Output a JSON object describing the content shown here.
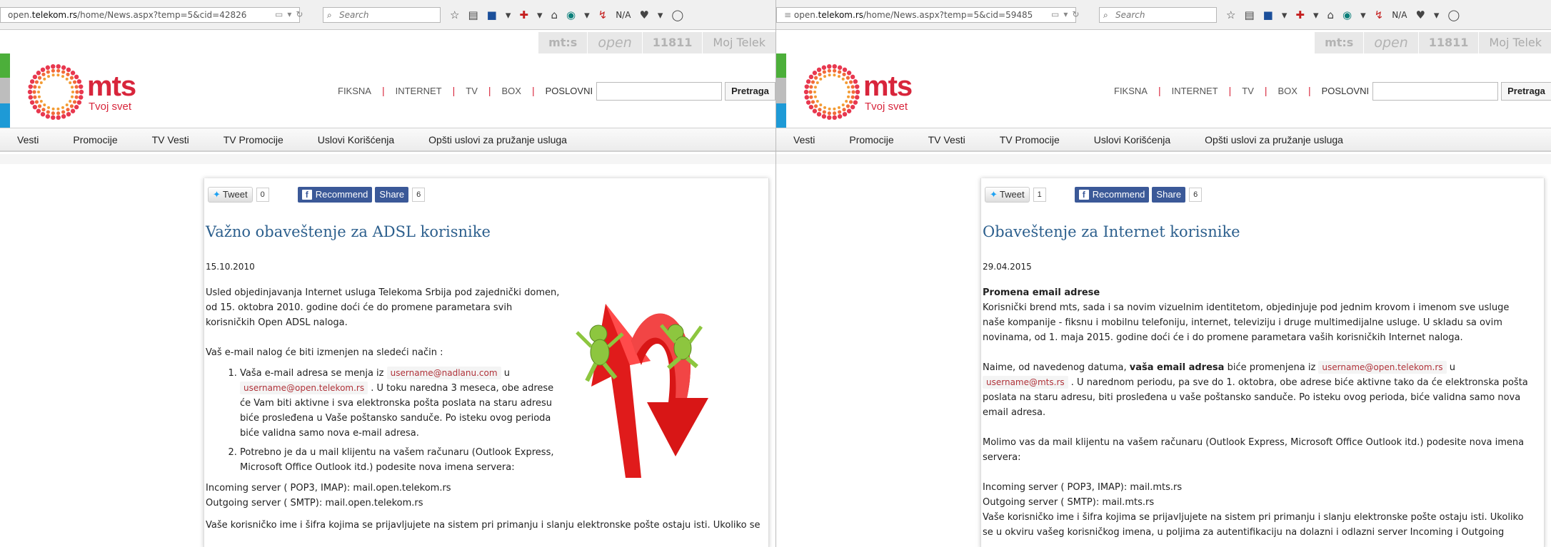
{
  "left": {
    "url_prefix": "open.",
    "url_domain": "telekom.rs",
    "url_path": "/home/News.aspx?temp=5&cid=42826",
    "search_placeholder": "Search",
    "toolbar_na": "N/A",
    "brand_tabs": [
      "mt:s",
      "open",
      "11811",
      "Moj Telek"
    ],
    "logo_text": "mts",
    "tagline": "Tvoj svet",
    "top_nav": [
      "FIKSNA",
      "INTERNET",
      "TV",
      "BOX",
      "POSLOVNI"
    ],
    "search_button": "Pretraga",
    "nav": [
      "Vesti",
      "Promocije",
      "TV Vesti",
      "TV Promocije",
      "Uslovi Korišćenja",
      "Opšti uslovi za pružanje usluga"
    ],
    "tweet_label": "Tweet",
    "tweet_count": "0",
    "recommend_label": "Recommend",
    "share_label": "Share",
    "share_count": "6",
    "title": "Važno obaveštenje za ADSL korisnike",
    "date": "15.10.2010",
    "p1": "Usled objedinjavanja Internet usluga Telekoma Srbija pod zajednički domen, od 15. oktobra 2010. godine doći će do promene parametara svih korisničkih Open ADSL naloga.",
    "p2": "Vaš e-mail nalog  će biti izmenjen na sledeći način :",
    "li1_a": "Vaša e-mail adresa se menja iz",
    "li1_code1": "username@nadlanu.com",
    "li1_u": "u",
    "li1_code2": "username@open.telekom.rs",
    "li1_b": ". U toku naredna 3 meseca, obe adrese će Vam biti aktivne i sva elektronska pošta poslata na staru adresu biće prosleđena u Vaše poštansko sanduče. Po isteku ovog perioda biće validna samo nova e-mail adresa.",
    "li2": "Potrebno je da u mail klijentu na vašem računaru (Outlook Express, Microsoft Office Outlook itd.)  podesite nova imena servera:",
    "incoming": "Incoming server ( POP3, IMAP): mail.open.telekom.rs",
    "outgoing": "Outgoing server ( SMTP): mail.open.telekom.rs",
    "p_last": "Vaše korisničko ime i šifra kojima se prijavljujete na sistem pri primanju i slanju elektronske pošte ostaju isti. Ukoliko se"
  },
  "right": {
    "url_prefix": "open.",
    "url_domain": "telekom.rs",
    "url_path": "/home/News.aspx?temp=5&cid=59485",
    "search_placeholder": "Search",
    "toolbar_na": "N/A",
    "brand_tabs": [
      "mt:s",
      "open",
      "11811",
      "Moj Telek"
    ],
    "logo_text": "mts",
    "tagline": "Tvoj svet",
    "top_nav": [
      "FIKSNA",
      "INTERNET",
      "TV",
      "BOX",
      "POSLOVNI"
    ],
    "search_button": "Pretraga",
    "nav": [
      "Vesti",
      "Promocije",
      "TV Vesti",
      "TV Promocije",
      "Uslovi Korišćenja",
      "Opšti uslovi za pružanje usluga"
    ],
    "tweet_label": "Tweet",
    "tweet_count": "1",
    "recommend_label": "Recommend",
    "share_label": "Share",
    "share_count": "6",
    "title": "Obaveštenje za Internet korisnike",
    "date": "29.04.2015",
    "heading": "Promena email adrese",
    "p1": "Korisnički brend mts, sada i sa novim vizuelnim identitetom, objedinjuje pod jednim krovom i imenom sve usluge naše kompanije - fiksnu i mobilnu telefoniju, internet, televiziju i druge multimedijalne usluge. U skladu sa ovim novinama, od 1. maja 2015. godine doći će i do promene parametara vaših korisničkih Internet naloga.",
    "p2_a": "Naime, od navedenog datuma,",
    "p2_bold": "vaša email adresa",
    "p2_b": "biće promenjena iz",
    "p2_code1": "username@open.telekom.rs",
    "p2_u": "u",
    "p2_code2": "username@mts.rs",
    "p2_c": ". U narednom periodu, pa sve do 1. oktobra, obe adrese biće aktivne tako da će elektronska pošta poslata na staru adresu, biti prosleđena u vaše poštansko sanduče. Po isteku ovog perioda, biće validna samo nova email adresa.",
    "p3": "Molimo vas da mail klijentu na vašem računaru (Outlook Express, Microsoft Office Outlook itd.) podesite nova imena servera:",
    "incoming": "Incoming server ( POP3, IMAP): mail.mts.rs",
    "outgoing": "Outgoing server ( SMTP): mail.mts.rs",
    "p4": "Vaše korisničko ime i šifra kojima se prijavljujete na sistem pri primanju i slanju elektronske pošte ostaju isti. Ukoliko se u okviru vašeg korisničkog imena, u poljima za autentifikaciju na dolazni i odlazni server Incoming i Outgoing"
  },
  "colors": {
    "brand_red": "#d8253b",
    "title_blue": "#2c5f8d",
    "facebook_blue": "#3b5998"
  }
}
